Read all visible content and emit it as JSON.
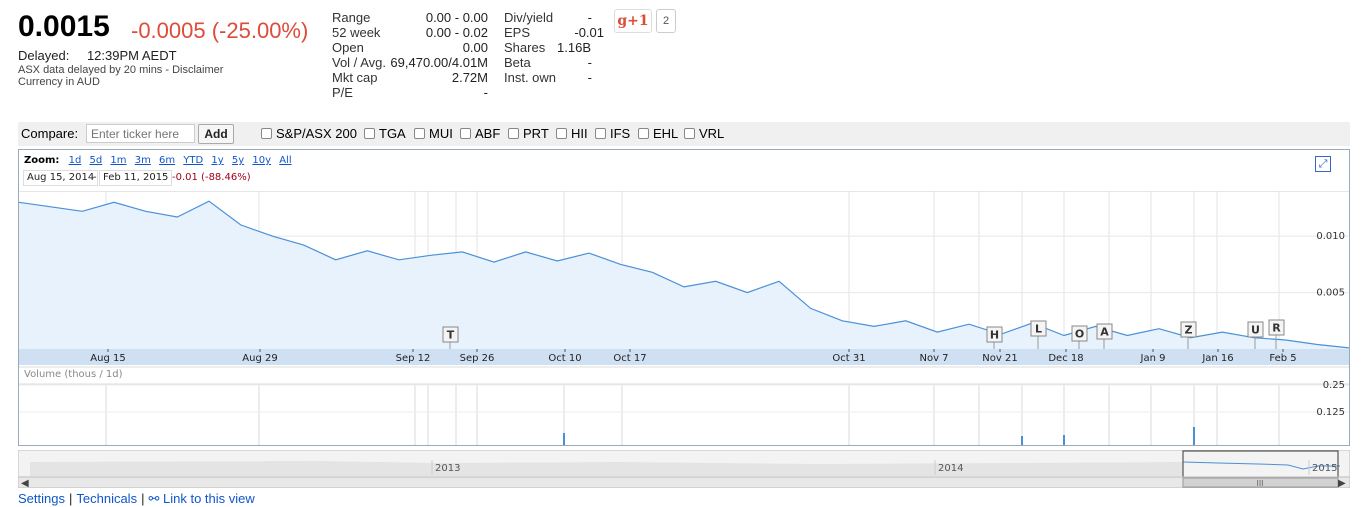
{
  "quote": {
    "price": "0.0015",
    "change": "-0.0005 (-25.00%)",
    "delayed_label": "Delayed:",
    "delayed_time": "12:39PM AEDT",
    "note1": "ASX data delayed by 20 mins - Disclaimer",
    "note2": "Currency in AUD"
  },
  "stats_left": [
    {
      "k": "Range",
      "v": "0.00 - 0.00"
    },
    {
      "k": "52 week",
      "v": "0.00 - 0.02"
    },
    {
      "k": "Open",
      "v": "0.00"
    },
    {
      "k": "Vol / Avg.",
      "v": "69,470.00/4.01M"
    },
    {
      "k": "Mkt cap",
      "v": "2.72M"
    },
    {
      "k": "P/E",
      "v": "-"
    }
  ],
  "stats_right": [
    {
      "k": "Div/yield",
      "v": "-"
    },
    {
      "k": "EPS",
      "v": "-0.01"
    },
    {
      "k": "Shares",
      "v": "1.16B"
    },
    {
      "k": "Beta",
      "v": "-"
    },
    {
      "k": "Inst. own",
      "v": "-"
    }
  ],
  "gplus": {
    "label": "g+1",
    "count": "2"
  },
  "compare": {
    "label": "Compare:",
    "placeholder": "Enter ticker here",
    "add_label": "Add",
    "tickers": [
      "S&P/ASX 200",
      "TGA",
      "MUI",
      "ABF",
      "PRT",
      "HII",
      "IFS",
      "EHL",
      "VRL"
    ]
  },
  "zoom": {
    "label": "Zoom:",
    "options": [
      "1d",
      "5d",
      "1m",
      "3m",
      "6m",
      "YTD",
      "1y",
      "5y",
      "10y",
      "All"
    ],
    "from_date": "Aug 15, 2014",
    "dash": "-",
    "to_date": "Feb 11, 2015",
    "range_change": "-0.01 (-88.46%)"
  },
  "volume_label": "Volume (thous / 1d)",
  "footer": {
    "settings": "Settings",
    "technicals": "Technicals",
    "link": "Link to this view",
    "sep": "|"
  },
  "chart_data": {
    "type": "area",
    "x_tick_labels": [
      "Aug 15",
      "Aug 29",
      "Sep 12",
      "Sep 26",
      "Oct 10",
      "Oct 17",
      "Oct 31",
      "Nov 7",
      "Nov 21",
      "Dec 18",
      "Jan 9",
      "Jan 16",
      "Feb 5"
    ],
    "y_tick_labels": [
      "0.010",
      "0.005"
    ],
    "ylim": [
      0,
      0.014
    ],
    "series": [
      {
        "values": [
          0.013,
          0.0126,
          0.0122,
          0.013,
          0.0122,
          0.0117,
          0.0131,
          0.011,
          0.01,
          0.0092,
          0.0079,
          0.0087,
          0.0079,
          0.0083,
          0.0086,
          0.0077,
          0.0086,
          0.0078,
          0.0085,
          0.0075,
          0.0068,
          0.0055,
          0.006,
          0.005,
          0.006,
          0.0036,
          0.0025,
          0.002,
          0.0025,
          0.0015,
          0.0022,
          0.0013,
          0.0023,
          0.0012,
          0.002,
          0.0012,
          0.0018,
          0.001,
          0.0015,
          0.001,
          0.0008,
          0.0004,
          0.0001
        ],
        "color": "#4a90d9"
      }
    ],
    "news_flags": [
      "T",
      "H",
      "L",
      "O",
      "A",
      "Z",
      "U",
      "R"
    ],
    "volume_ticks": [
      "0.25",
      "0.125"
    ],
    "navigator_labels": [
      "2013",
      "2014",
      "2015"
    ],
    "grid": true
  },
  "colors": {
    "accent": "#1155cc",
    "negative": "#dd4b39",
    "line": "#4a90d9",
    "fill": "#e8f2fc"
  }
}
